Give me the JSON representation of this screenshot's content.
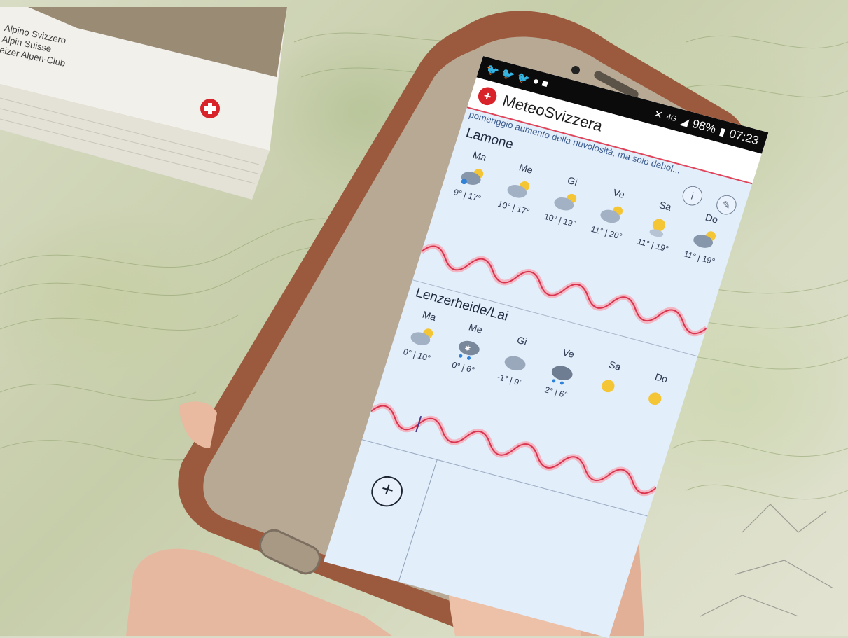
{
  "book": {
    "lines": [
      "Alpino Svizzero",
      "Alpin Suisse",
      "eizer Alpen-Club"
    ]
  },
  "statusbar": {
    "battery": "98%",
    "time": "07:23",
    "network": "4G"
  },
  "app": {
    "title": "MeteoSvizzera",
    "ticker": "pomeriggio aumento della nuvolosità, ma solo debol..."
  },
  "locations": [
    {
      "name": "Lamone",
      "days": [
        {
          "day": "Ma",
          "temps": "9° | 17°",
          "icon": "sun-cloud-rain-icon"
        },
        {
          "day": "Me",
          "temps": "10° | 17°",
          "icon": "sun-cloud-icon"
        },
        {
          "day": "Gi",
          "temps": "10° | 19°",
          "icon": "sun-cloud-icon"
        },
        {
          "day": "Ve",
          "temps": "11° | 20°",
          "icon": "sun-cloud-icon"
        },
        {
          "day": "Sa",
          "temps": "11° | 19°",
          "icon": "sun-icon"
        },
        {
          "day": "Do",
          "temps": "11° | 19°",
          "icon": "sun-cloud-icon"
        }
      ]
    },
    {
      "name": "Lenzerheide/Lai",
      "days": [
        {
          "day": "Ma",
          "temps": "0° | 10°",
          "icon": "sun-cloud-icon"
        },
        {
          "day": "Me",
          "temps": "0° | 6°",
          "icon": "snow-cloud-icon"
        },
        {
          "day": "Gi",
          "temps": "-1° | 9°",
          "icon": "cloud-icon"
        },
        {
          "day": "Ve",
          "temps": "2° | 6°",
          "icon": "rain-cloud-icon"
        },
        {
          "day": "Sa",
          "temps": "",
          "icon": "sun-icon"
        },
        {
          "day": "Do",
          "temps": "",
          "icon": "sun-icon"
        }
      ]
    }
  ],
  "colors": {
    "accent_red": "#e0445a",
    "screen_bg": "#e3eefb",
    "statusbar_bg": "#0b0b0b",
    "phone_case": "#9b5a3e"
  },
  "add_button": {
    "label": "+"
  }
}
